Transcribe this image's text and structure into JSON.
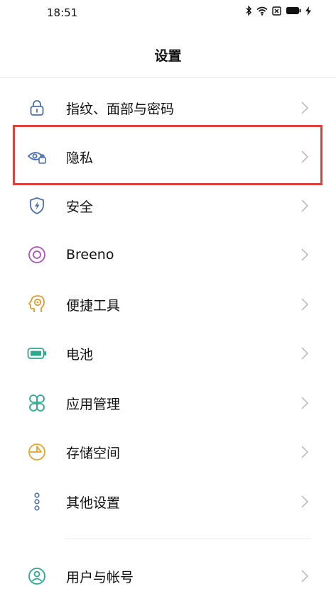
{
  "status_bar": {
    "time": "18:51",
    "icons": [
      "bluetooth-icon",
      "wifi-icon",
      "sim-icon",
      "battery-icon",
      "charging-icon"
    ]
  },
  "header": {
    "title": "设置"
  },
  "items": [
    {
      "label": "指纹、面部与密码",
      "icon": "lock-icon",
      "color": "#4a6fb5"
    },
    {
      "label": "隐私",
      "icon": "privacy-eye-icon",
      "color": "#4a6fb5",
      "highlighted": true
    },
    {
      "label": "安全",
      "icon": "shield-bolt-icon",
      "color": "#4a6fb5"
    },
    {
      "label": "Breeno",
      "icon": "breeno-ring-icon",
      "color": "#b04fbf"
    },
    {
      "label": "便捷工具",
      "icon": "head-gear-icon",
      "color": "#e69a2b"
    },
    {
      "label": "电池",
      "icon": "battery-icon",
      "color": "#2aa98e"
    },
    {
      "label": "应用管理",
      "icon": "app-grid-icon",
      "color": "#2aa98e"
    },
    {
      "label": "存储空间",
      "icon": "storage-pie-icon",
      "color": "#e6a52b"
    },
    {
      "label": "其他设置",
      "icon": "more-dots-icon",
      "color": "#4a6fb5"
    },
    {
      "label": "用户与帐号",
      "icon": "user-icon",
      "color": "#2aa98e"
    }
  ],
  "colors": {
    "highlight_border": "#e0403a",
    "chevron": "#bdbdbd"
  }
}
